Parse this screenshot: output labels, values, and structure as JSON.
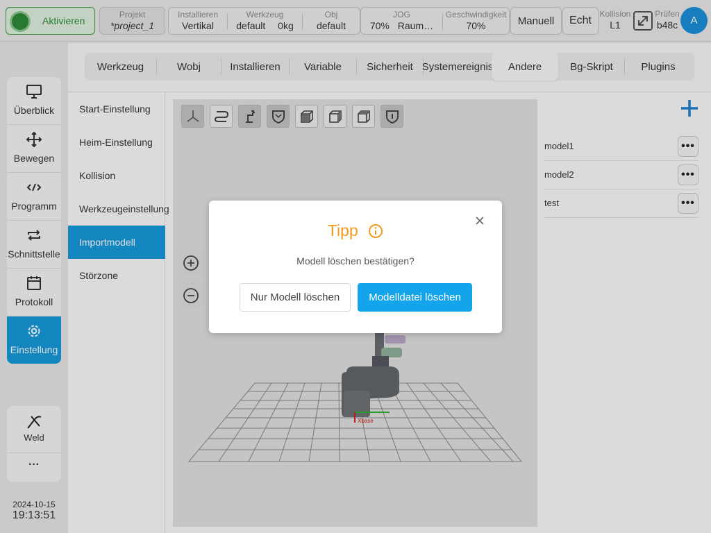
{
  "topbar": {
    "activate_label": "Aktivieren",
    "project": {
      "label": "Projekt",
      "value": "*project_1"
    },
    "install": {
      "label": "Installieren",
      "value": "Vertikal"
    },
    "tool": {
      "label": "Werkzeug",
      "value": "default",
      "payload": "0kg"
    },
    "obj": {
      "label": "Obj",
      "value": "default"
    },
    "jog": {
      "label": "JOG",
      "value": "70%",
      "mode": "Raum…"
    },
    "speed": {
      "label": "Geschwindigkeit",
      "value": "70%"
    },
    "manual_label": "Manuell",
    "real_label": "Echt",
    "collision": {
      "label": "Kollision",
      "value": "L1"
    },
    "check": {
      "label": "Prüfen",
      "value": "b48c"
    },
    "avatar_letter": "A"
  },
  "nav": {
    "items": [
      {
        "label": "Überblick",
        "icon": "monitor-icon"
      },
      {
        "label": "Bewegen",
        "icon": "move-arrows-icon"
      },
      {
        "label": "Programm",
        "icon": "code-icon"
      },
      {
        "label": "Schnittstelle",
        "icon": "interface-arrows-icon"
      },
      {
        "label": "Protokoll",
        "icon": "calendar-icon"
      },
      {
        "label": "Einstellung",
        "icon": "gear-icon",
        "active": true
      }
    ],
    "weld_label": "Weld",
    "more_label": "···"
  },
  "datetime": {
    "date": "2024-10-15",
    "time": "19:13:51"
  },
  "tabs": [
    "Werkzeug",
    "Wobj",
    "Installieren",
    "Variable",
    "Sicherheit",
    "Systemereignis",
    "Andere",
    "Bg-Skript",
    "Plugins"
  ],
  "active_tab": "Andere",
  "submenu": [
    "Start-Einstellung",
    "Heim-Einstellung",
    "Kollision",
    "Werkzeugeinstellung",
    "Importmodell",
    "Störzone"
  ],
  "active_submenu": "Importmodell",
  "viewport": {
    "axis_label": "Xbase"
  },
  "models": [
    "model1",
    "model2",
    "test"
  ],
  "dialog": {
    "title": "Tipp",
    "message": "Modell löschen bestätigen?",
    "secondary_label": "Nur Modell löschen",
    "primary_label": "Modelldatei löschen"
  },
  "colors": {
    "accent": "#1699db",
    "primary_button": "#13a4ec",
    "title": "#f29a1c",
    "activate": "#2e8a3a"
  }
}
